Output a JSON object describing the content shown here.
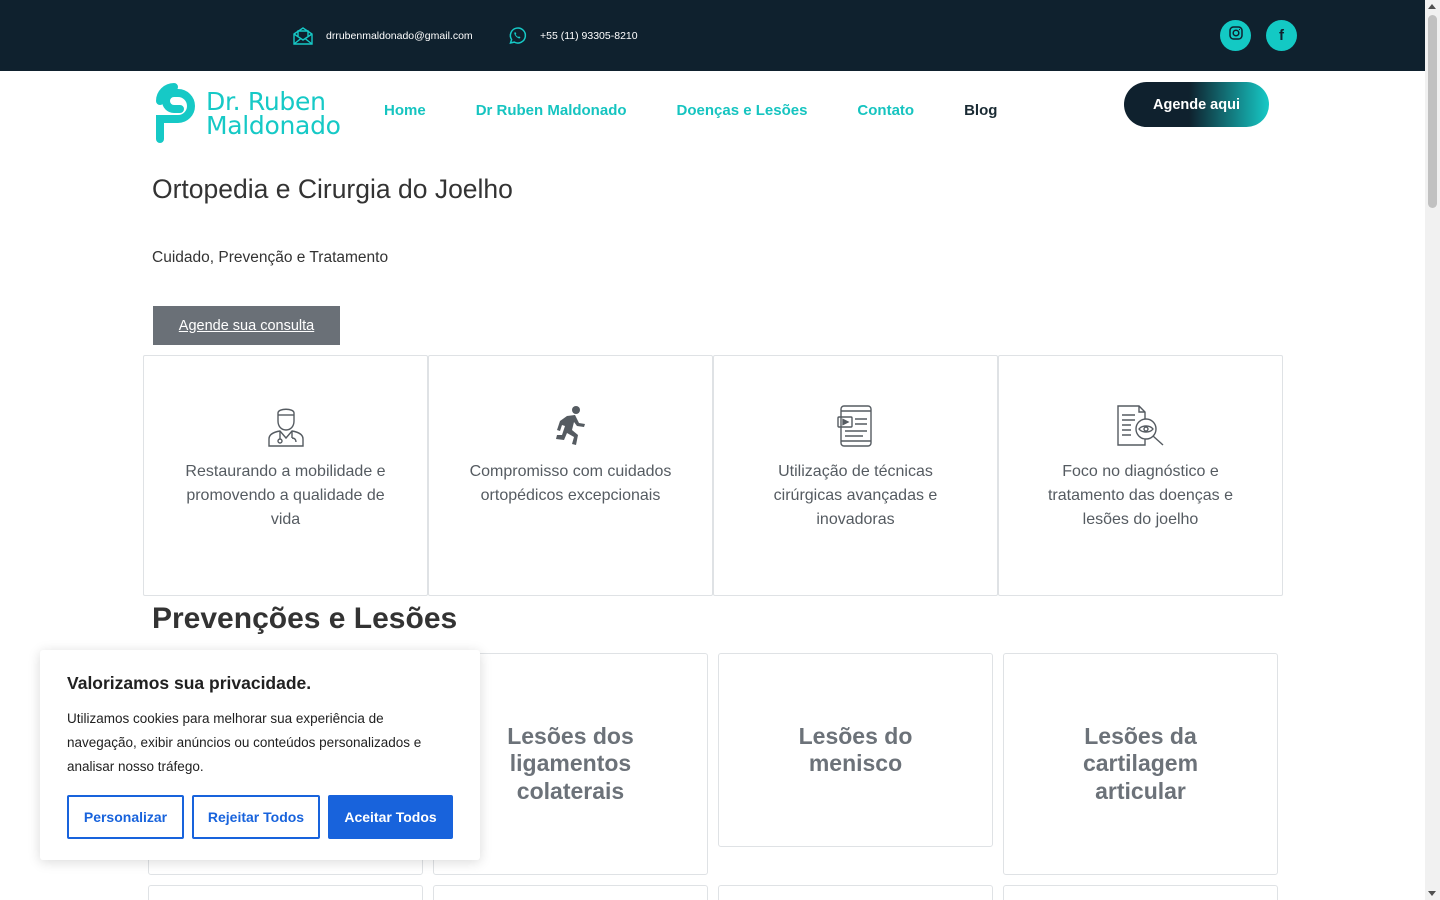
{
  "topbar": {
    "email": "drrubenmaldonado@gmail.com",
    "phone": "+55 (11) 93305-8210",
    "email_icon": "envelope-open-icon",
    "phone_icon": "whatsapp-icon",
    "social": [
      "instagram-icon",
      "facebook-icon"
    ],
    "facebook_glyph": "f"
  },
  "header": {
    "logo_line1": "Dr. Ruben",
    "logo_line2": "Maldonado",
    "nav": [
      "Home",
      "Dr Ruben Maldonado",
      "Doenças e Lesões",
      "Contato",
      "Blog"
    ],
    "cta": "Agende aqui"
  },
  "hero": {
    "title": "Ortopedia e Cirurgia do Joelho",
    "subtitle": "Cuidado, Prevenção e Tratamento",
    "button": "Agende sua consulta"
  },
  "features": [
    {
      "icon": "doctor-icon",
      "text": "Restaurando a mobilidade e promovendo a qualidade de vida"
    },
    {
      "icon": "running-person-icon",
      "text": "Compromisso com cuidados ortopédicos excepcionais"
    },
    {
      "icon": "tablet-video-icon",
      "text": "Utilização de técnicas cirúrgicas avançadas e inovadoras"
    },
    {
      "icon": "document-search-icon",
      "text": "Foco no diagnóstico e tratamento das doenças e lesões do joelho"
    }
  ],
  "section": {
    "title": "Prevenções e Lesões",
    "cards": [
      "Lesões dos ligamentos colaterais",
      "Lesões do menisco",
      "Lesões da cartilagem articular"
    ]
  },
  "cookie": {
    "title": "Valorizamos sua privacidade.",
    "text": "Utilizamos cookies para melhorar sua experiência de navegação, exibir anúncios ou conteúdos personalizados e analisar nosso tráfego.",
    "customize": "Personalizar",
    "reject": "Rejeitar Todos",
    "accept": "Aceitar Todos"
  },
  "colors": {
    "topbar": "#0f212e",
    "accent": "#16c9c6",
    "cookie_primary": "#1863dc"
  }
}
